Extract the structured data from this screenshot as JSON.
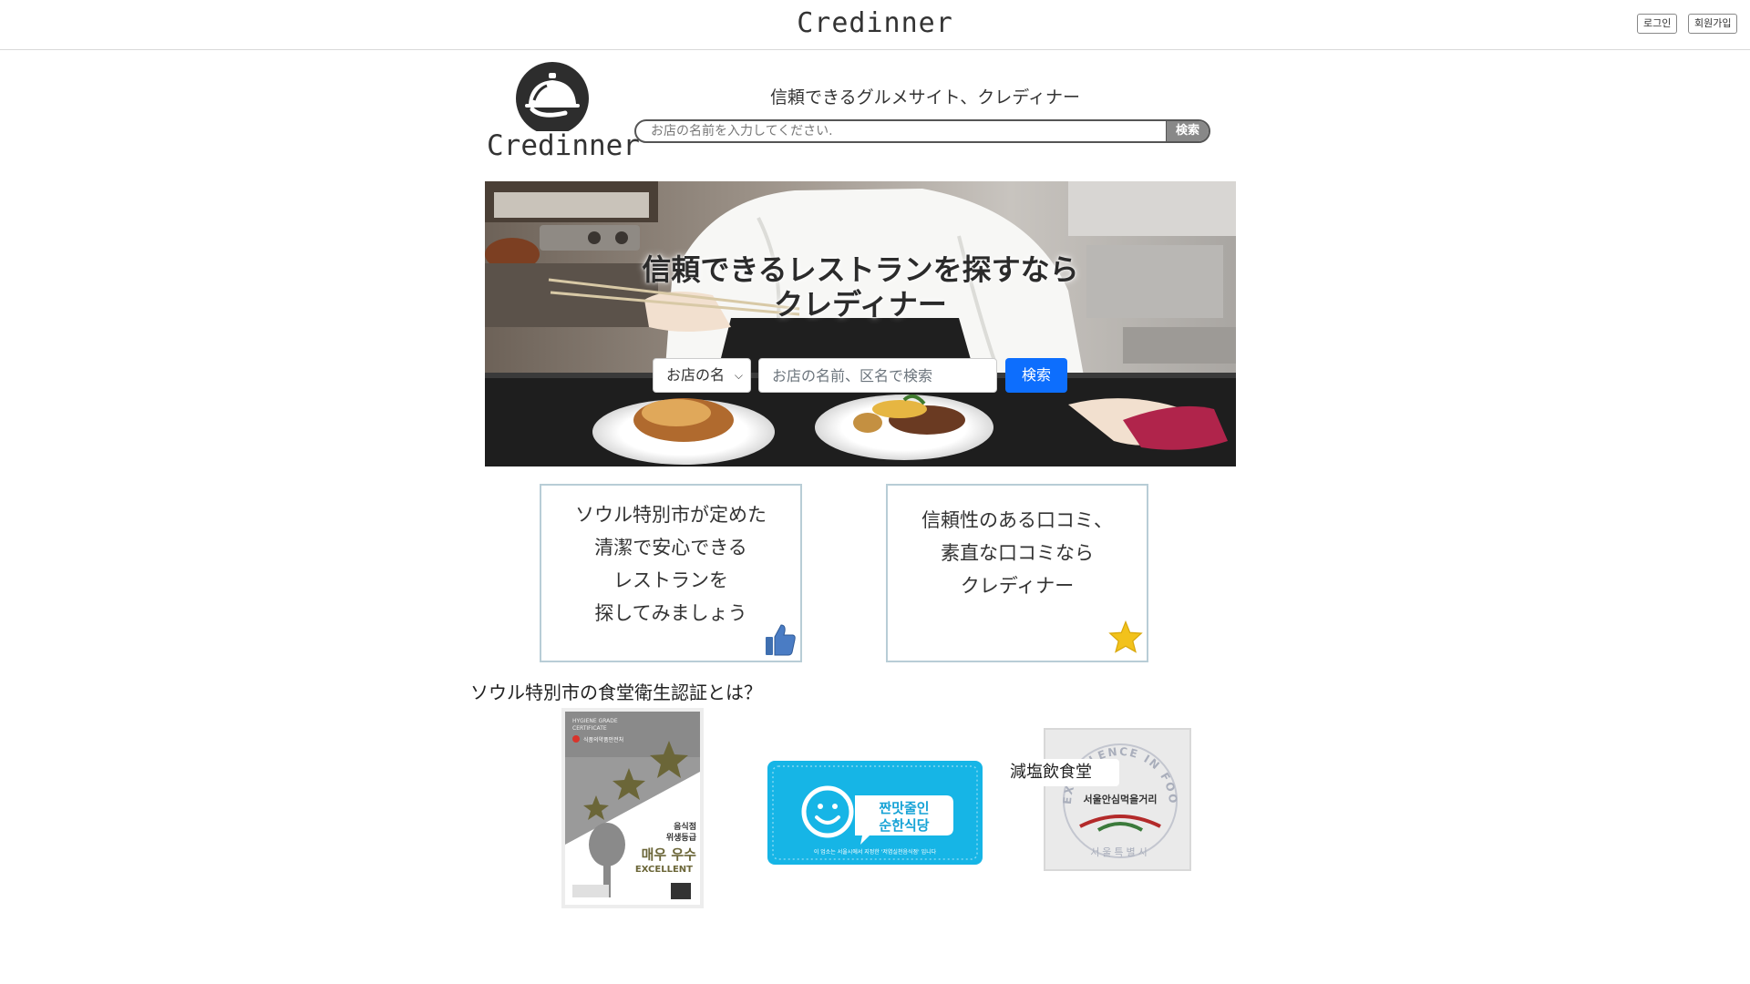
{
  "header": {
    "title": "Credinner",
    "login_label": "로그인",
    "signup_label": "회원가입"
  },
  "brand": {
    "logo_word": "Credinner",
    "tagline": "信頼できるグルメサイト、クレディナー"
  },
  "top_search": {
    "placeholder": "お店の名前を入力してください.",
    "button_label": "検索"
  },
  "hero": {
    "headline_line1": "信頼できるレストランを探すなら",
    "headline_line2": "クレディナー",
    "select_value": "お店の名",
    "input_placeholder": "お店の名前、区名で検索",
    "button_label": "検索",
    "button_color": "#0d6efd"
  },
  "cards": [
    {
      "lines": [
        "ソウル特別市が定めた",
        "清潔で安心できる",
        "レストランを",
        "探してみましょう"
      ],
      "icon": "thumbs-up-icon"
    },
    {
      "lines": [
        "信頼性のある口コミ、",
        "素直な口コミなら",
        "クレディナー"
      ],
      "icon": "star-icon"
    }
  ],
  "certification": {
    "title": "ソウル特別市の食堂衛生認証とは？",
    "poster": {
      "header_line1": "HYGIENE GRADE",
      "header_line2": "CERTIFICATE",
      "ministry": "식품의약품안전처",
      "grade_line1": "음식점",
      "grade_line2": "위생등급",
      "grade_ko": "매우 우수",
      "grade_en": "EXCELLENT"
    },
    "blue_sign": {
      "line1": "짠맛줄인",
      "line2": "순한식당",
      "footer": "이 업소는 서울시에서 지정한 '저염실천음식점' 입니다"
    },
    "salt_label": "減塩飲食堂",
    "seal": {
      "arc_text": "EXCELLENCE IN FOOD SAFETY",
      "center_text": "서울안심먹을거리",
      "bottom_text": "서울특별시"
    }
  }
}
